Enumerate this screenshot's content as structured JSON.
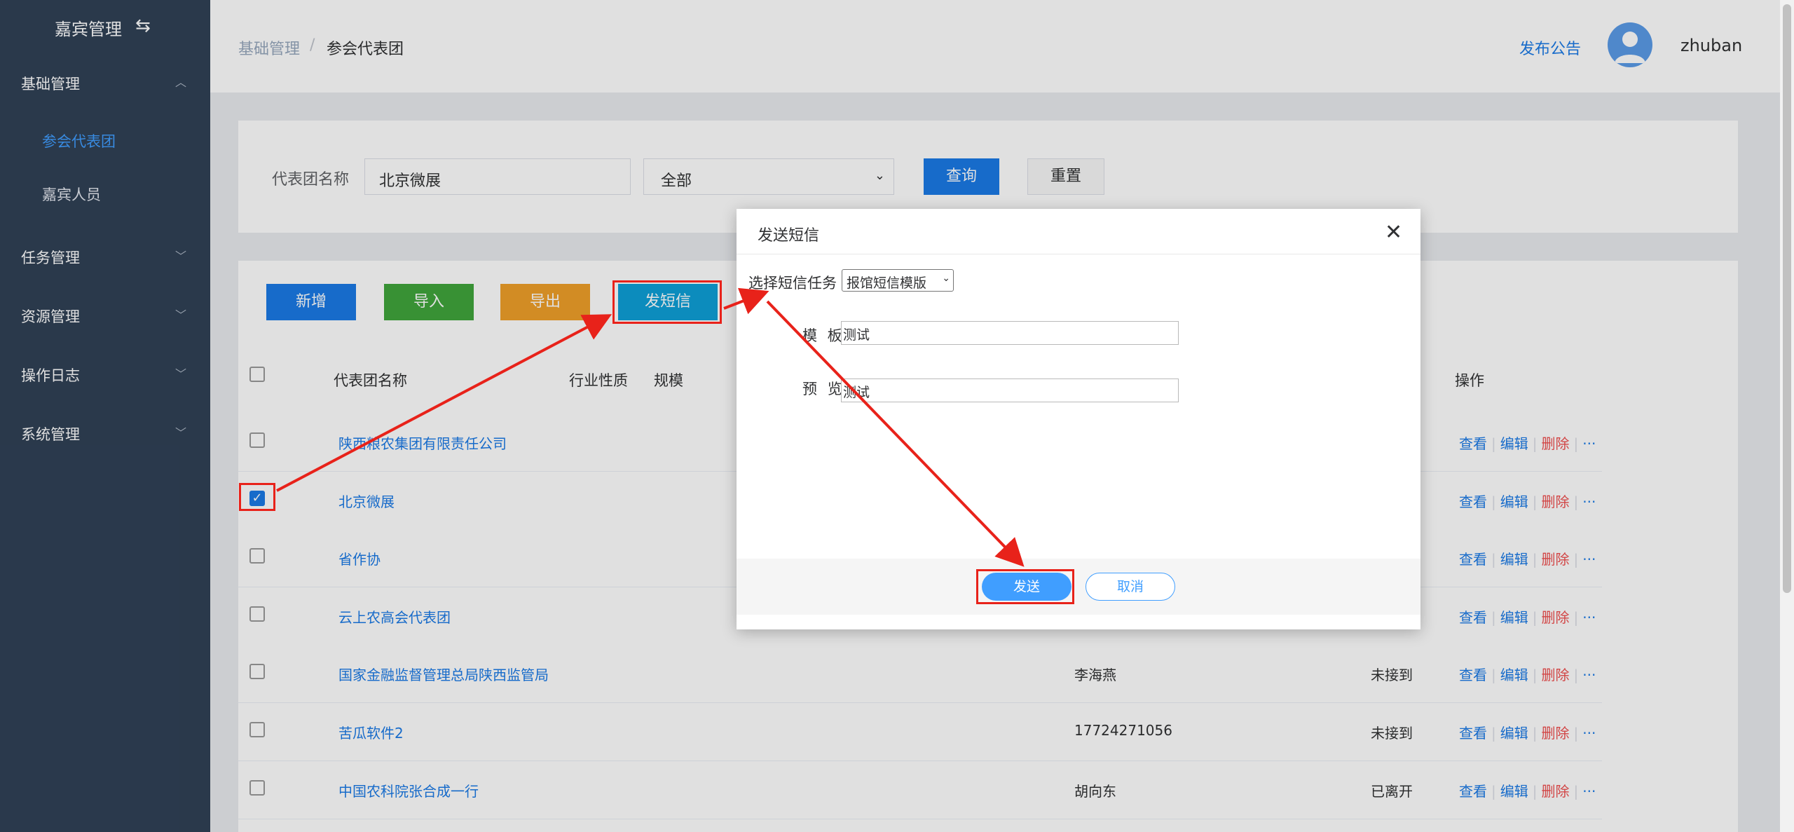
{
  "sidebar": {
    "title": "嘉宾管理",
    "switch_icon": "switch-icon",
    "menus": [
      {
        "label": "基础管理",
        "expanded": true
      },
      {
        "label": "任务管理"
      },
      {
        "label": "资源管理"
      },
      {
        "label": "操作日志"
      },
      {
        "label": "系统管理"
      }
    ],
    "submenu": [
      "参会代表团",
      "嘉宾人员"
    ]
  },
  "header": {
    "breadcrumb": [
      "基础管理",
      "/",
      "参会代表团"
    ],
    "notice_label": "发布公告",
    "username": "zhuban"
  },
  "search": {
    "label": "代表团名称",
    "name_value": "北京微展",
    "select_value": "全部",
    "query_label": "查询",
    "reset_label": "重置"
  },
  "toolbar": {
    "add_label": "新增",
    "import_label": "导入",
    "export_label": "导出",
    "sms_label": "发短信"
  },
  "table": {
    "columns": [
      "代表团名称",
      "行业性质",
      "规模",
      "操作"
    ],
    "rows": [
      {
        "name": "陕西粮农集团有限责任公司",
        "contact": "",
        "status": "",
        "checked": false
      },
      {
        "name": "北京微展",
        "contact": "",
        "status": "",
        "checked": true
      },
      {
        "name": "省作协",
        "contact": "",
        "status": "",
        "checked": false
      },
      {
        "name": "云上农高会代表团",
        "contact": "",
        "status": "",
        "checked": false
      },
      {
        "name": "国家金融监督管理总局陕西监管局",
        "contact": "李海燕",
        "status": "未接到",
        "checked": false
      },
      {
        "name": "苦瓜软件2",
        "contact": "17724271056",
        "status": "未接到",
        "checked": false
      },
      {
        "name": "中国农科院张合成一行",
        "contact": "胡向东",
        "status": "已离开",
        "checked": false
      }
    ],
    "ops": {
      "view": "查看",
      "edit": "编辑",
      "delete": "删除",
      "more": "···",
      "sep": "|"
    }
  },
  "dialog": {
    "title": "发送短信",
    "task_label": "选择短信任务",
    "task_value": "报馆短信模版",
    "template_label": "模 板",
    "template_value": "测试",
    "preview_label": "预 览",
    "preview_value": "测试",
    "send_label": "发送",
    "cancel_label": "取消"
  },
  "colors": {
    "sidebar_bg": "#304156",
    "primary": "#1b7ae6",
    "success": "#40a63c",
    "warning": "#f0a02a",
    "info": "#0ea0d8",
    "danger": "#ef4f4f",
    "annotation_red": "#e8221a"
  }
}
